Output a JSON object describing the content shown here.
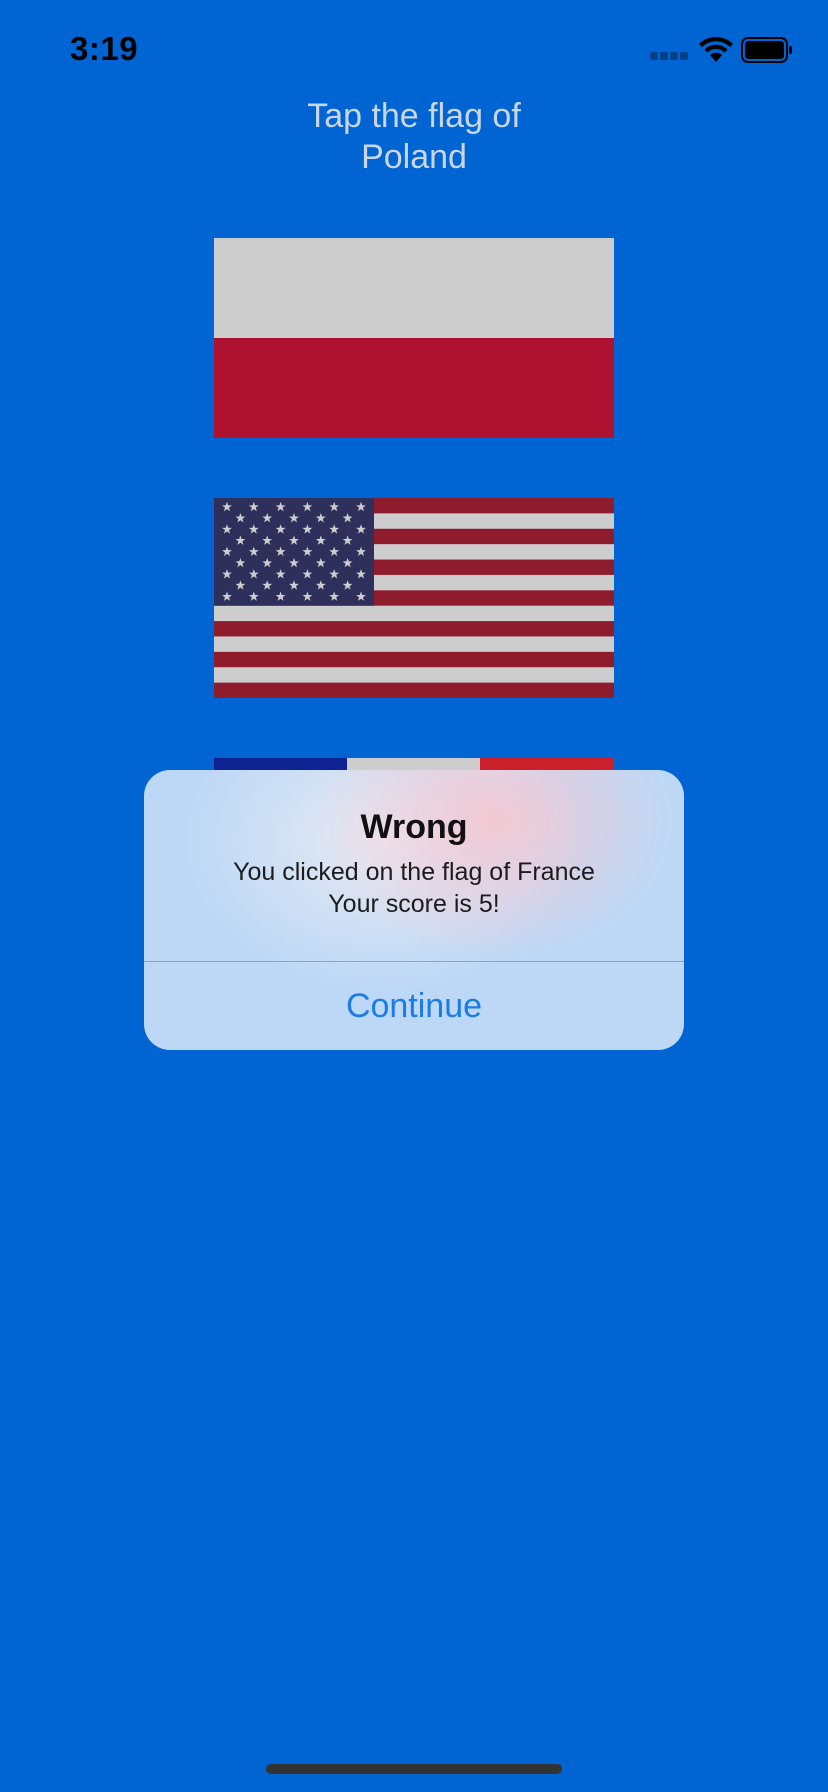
{
  "status_bar": {
    "time": "3:19",
    "icons": [
      "cellular-signal-icon",
      "wifi-icon",
      "battery-icon"
    ]
  },
  "prompt": {
    "line1": "Tap the flag of",
    "line2": "Poland"
  },
  "flags": [
    {
      "country": "Poland",
      "icon": "flag-poland"
    },
    {
      "country": "United States",
      "icon": "flag-usa"
    },
    {
      "country": "France",
      "icon": "flag-france"
    }
  ],
  "alert": {
    "title": "Wrong",
    "message_line1": "You clicked on the flag of France",
    "message_line2": "Your score is 5!",
    "button_label": "Continue"
  },
  "colors": {
    "background": "#0064D2",
    "prompt_text": "#C9D6E6",
    "alert_button": "#1A7CE8",
    "poland_white": "#CDCDCD",
    "poland_red": "#AE1230",
    "usa_red": "#8F1C2D",
    "usa_white": "#CDCDCD",
    "usa_blue": "#2F2F5C",
    "france_blue": "#0F2291",
    "france_white": "#CDCDCD",
    "france_red": "#C9202C"
  }
}
